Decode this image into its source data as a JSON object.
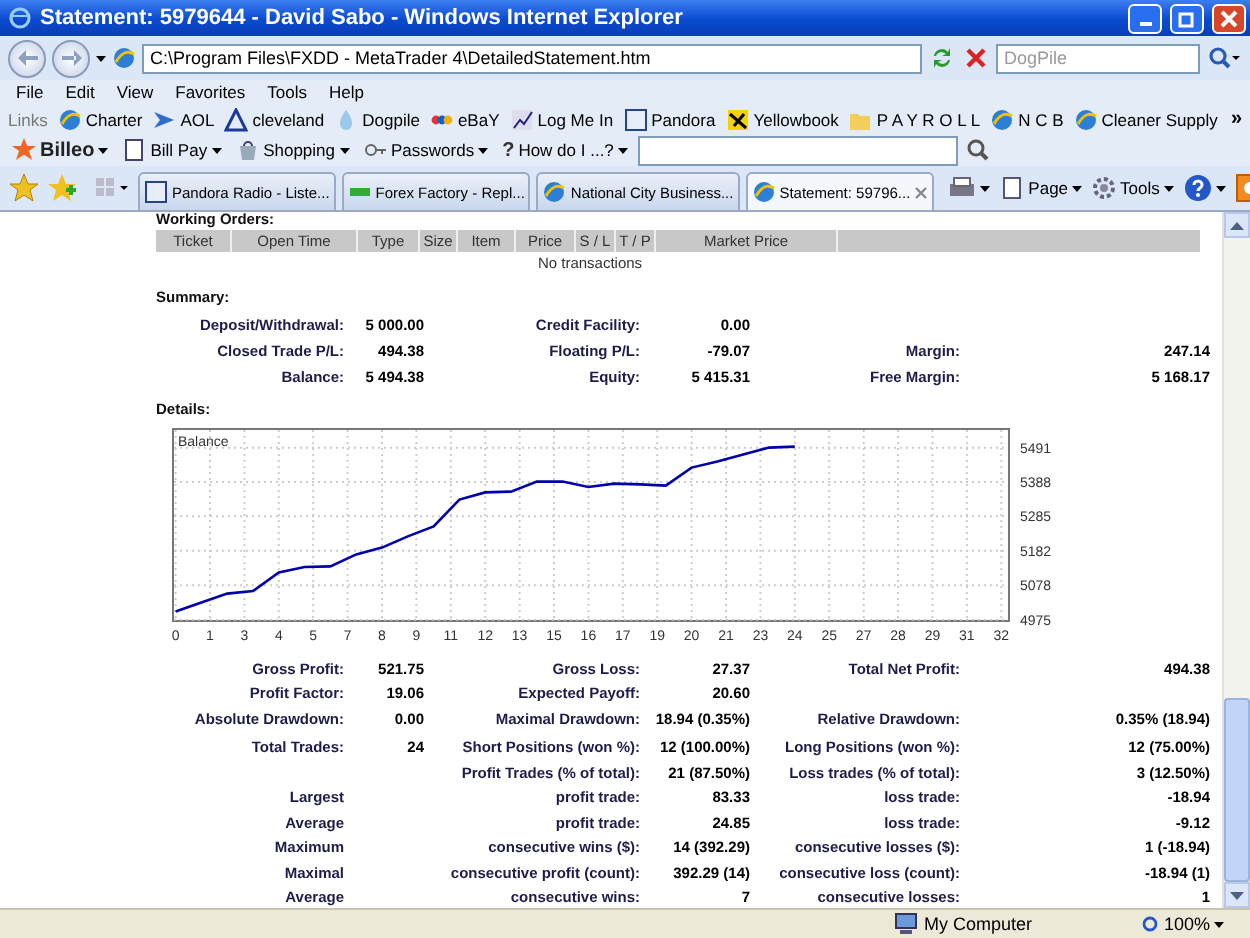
{
  "window": {
    "title": "Statement: 5979644 - David Sabo - Windows Internet Explorer"
  },
  "address_bar": {
    "url": "C:\\Program Files\\FXDD - MetaTrader 4\\DetailedStatement.htm",
    "search": {
      "placeholder": "DogPile"
    }
  },
  "menu": [
    "File",
    "Edit",
    "View",
    "Favorites",
    "Tools",
    "Help"
  ],
  "links_bar": {
    "label": "Links",
    "items": [
      "Charter",
      "AOL",
      "cleveland",
      "Dogpile",
      "eBaY",
      "Log Me In",
      "Pandora",
      "Yellowbook",
      "P A Y R O L L",
      "N C B",
      "Cleaner Supply"
    ],
    "more": "»"
  },
  "billeo_bar": {
    "items": [
      {
        "label": "Billeo",
        "kind": "logo"
      },
      {
        "label": "Bill Pay",
        "kind": "menu"
      },
      {
        "label": "Shopping",
        "kind": "menu"
      },
      {
        "label": "Passwords",
        "kind": "menu"
      },
      {
        "label": "How do I ...?",
        "kind": "menu",
        "prefix": "?"
      }
    ]
  },
  "tabs": [
    {
      "label": "Pandora Radio - Liste...",
      "selected": false
    },
    {
      "label": "Forex Factory - Repl...",
      "selected": false
    },
    {
      "label": "National City Business...",
      "selected": false
    },
    {
      "label": "Statement: 59796...",
      "selected": true
    }
  ],
  "command_bar": [
    "Page",
    "Tools"
  ],
  "page": {
    "working_orders": {
      "title": "Working Orders:",
      "columns": [
        "Ticket",
        "Open Time",
        "Type",
        "Size",
        "Item",
        "Price",
        "S / L",
        "T / P",
        "Market Price"
      ],
      "empty_text": "No transactions"
    },
    "summary": {
      "title": "Summary:",
      "rows": [
        [
          "Deposit/Withdrawal:",
          "5 000.00",
          "Credit Facility:",
          "0.00",
          null,
          null
        ],
        [
          "Closed Trade P/L:",
          "494.38",
          "Floating P/L:",
          "-79.07",
          "Margin:",
          "247.14"
        ],
        [
          "Balance:",
          "5 494.38",
          "Equity:",
          "5 415.31",
          "Free Margin:",
          "5 168.17"
        ]
      ]
    },
    "details": {
      "title": "Details:",
      "chart_data": {
        "type": "line",
        "grid": true,
        "x": [
          0,
          1,
          2,
          3,
          4,
          5,
          6,
          7,
          8,
          9,
          10,
          11,
          12,
          13,
          14,
          15,
          16,
          17,
          18,
          19,
          20,
          21,
          22,
          23,
          24
        ],
        "series": [
          {
            "name": "Balance",
            "color": "#0000aa",
            "values": [
              5000,
              5027,
              5053,
              5061,
              5117,
              5133,
              5135,
              5171,
              5191,
              5225,
              5255,
              5335,
              5357,
              5359,
              5389,
              5389,
              5373,
              5383,
              5381,
              5377,
              5431,
              5449,
              5471,
              5491,
              5494
            ]
          }
        ],
        "xlim": [
          -0.1,
          32.3
        ],
        "ylim": [
          4971,
          5547
        ],
        "xticks": [
          {
            "value": 0,
            "label": "0"
          },
          {
            "value": 1.333,
            "label": "1"
          },
          {
            "value": 2.667,
            "label": "3"
          },
          {
            "value": 4,
            "label": "4"
          },
          {
            "value": 5.333,
            "label": "5"
          },
          {
            "value": 6.667,
            "label": "7"
          },
          {
            "value": 8,
            "label": "8"
          },
          {
            "value": 9.333,
            "label": "9"
          },
          {
            "value": 10.667,
            "label": "11"
          },
          {
            "value": 12,
            "label": "12"
          },
          {
            "value": 13.333,
            "label": "13"
          },
          {
            "value": 14.667,
            "label": "15"
          },
          {
            "value": 16,
            "label": "16"
          },
          {
            "value": 17.333,
            "label": "17"
          },
          {
            "value": 18.667,
            "label": "19"
          },
          {
            "value": 20,
            "label": "20"
          },
          {
            "value": 21.333,
            "label": "21"
          },
          {
            "value": 22.667,
            "label": "23"
          },
          {
            "value": 24,
            "label": "24"
          },
          {
            "value": 25.333,
            "label": "25"
          },
          {
            "value": 26.667,
            "label": "27"
          },
          {
            "value": 28,
            "label": "28"
          },
          {
            "value": 29.333,
            "label": "29"
          },
          {
            "value": 30.667,
            "label": "31"
          },
          {
            "value": 32,
            "label": "32"
          }
        ],
        "yticks": [
          4975,
          5078,
          5182,
          5285,
          5388,
          5491
        ]
      }
    },
    "results": [
      {
        "rows": [
          [
            "Gross Profit:",
            "521.75",
            "Gross Loss:",
            "27.37",
            "Total Net Profit:",
            "494.38"
          ],
          [
            "Profit Factor:",
            "19.06",
            "Expected Payoff:",
            "20.60",
            null,
            null
          ],
          [
            "Absolute Drawdown:",
            "0.00",
            "Maximal Drawdown:",
            "18.94 (0.35%)",
            "Relative Drawdown:",
            "0.35% (18.94)"
          ]
        ]
      },
      {
        "rows": [
          [
            "Total Trades:",
            "24",
            "Short Positions (won %):",
            "12 (100.00%)",
            "Long Positions (won %):",
            "12 (75.00%)"
          ],
          [
            null,
            null,
            "Profit Trades (% of total):",
            "21 (87.50%)",
            "Loss trades (% of total):",
            "3 (12.50%)"
          ],
          [
            "Largest",
            null,
            "profit trade:",
            "83.33",
            "loss trade:",
            "-18.94"
          ],
          [
            "Average",
            null,
            "profit trade:",
            "24.85",
            "loss trade:",
            "-9.12"
          ],
          [
            "Maximum",
            null,
            "consecutive wins ($):",
            "14 (392.29)",
            "consecutive losses ($):",
            "1 (-18.94)"
          ],
          [
            "Maximal",
            null,
            "consecutive profit (count):",
            "392.29 (14)",
            "consecutive loss (count):",
            "-18.94 (1)"
          ],
          [
            "Average",
            null,
            "consecutive wins:",
            "7",
            "consecutive losses:",
            "1"
          ]
        ]
      }
    ]
  },
  "status_bar": {
    "zone": "My Computer",
    "zoom": "100%"
  }
}
